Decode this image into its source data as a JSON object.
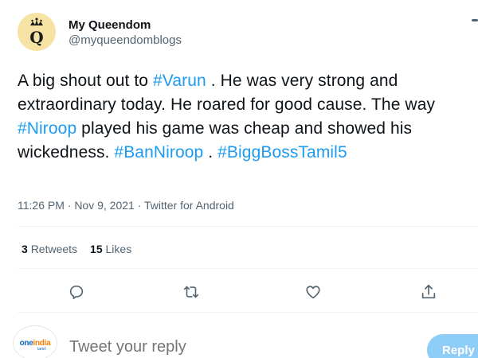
{
  "author": {
    "name": "My Queendom",
    "handle": "@myqueendomblogs",
    "avatar_letter": "Q"
  },
  "tweet": {
    "segments": [
      {
        "text": "A big shout out to ",
        "tag": false
      },
      {
        "text": "#Varun",
        "tag": true
      },
      {
        "text": " . He was very strong and extraordinary today. He roared for good cause. The way ",
        "tag": false
      },
      {
        "text": "#Niroop",
        "tag": true
      },
      {
        "text": " played his game was cheap and showed his wickedness. ",
        "tag": false
      },
      {
        "text": "#BanNiroop",
        "tag": true
      },
      {
        "text": " . ",
        "tag": false
      },
      {
        "text": "#BiggBossTamil5",
        "tag": true
      }
    ],
    "meta": "11:26 PM · Nov 9, 2021 · Twitter for Android"
  },
  "stats": {
    "retweets_count": "3",
    "retweets_label": "Retweets",
    "likes_count": "15",
    "likes_label": "Likes"
  },
  "actions": [
    "reply-icon",
    "retweet-icon",
    "like-icon",
    "share-icon"
  ],
  "reply_bar": {
    "placeholder": "Tweet your reply",
    "button_label": "Reply",
    "logo_text_a": "one",
    "logo_text_b": "india",
    "logo_sub": "tamil"
  },
  "colors": {
    "link": "#1d9bf0",
    "text": "#0f1419",
    "muted": "#536471",
    "reply_button": "#8ecdf8"
  }
}
